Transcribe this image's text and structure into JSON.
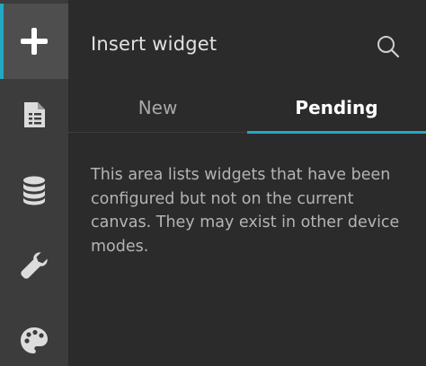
{
  "sidebar": {
    "items": [
      {
        "icon": "plus-icon",
        "active": true
      },
      {
        "icon": "page-icon",
        "active": false
      },
      {
        "icon": "database-icon",
        "active": false
      },
      {
        "icon": "wrench-icon",
        "active": false
      },
      {
        "icon": "palette-icon",
        "active": false
      }
    ]
  },
  "panel": {
    "title": "Insert widget",
    "search_icon": "search-icon",
    "tabs": [
      {
        "label": "New",
        "active": false
      },
      {
        "label": "Pending",
        "active": true
      }
    ],
    "message": "This area lists widgets that have been configured but not on the current canvas. They may exist in other device modes."
  },
  "colors": {
    "accent": "#21a9c4",
    "rail_bg": "#3c3c3c",
    "rail_active_bg": "#4e4e4e",
    "panel_bg": "#2b2b2b"
  }
}
